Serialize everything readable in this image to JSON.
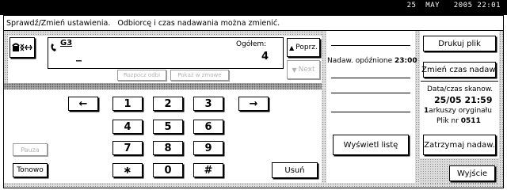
{
  "status_bar": {
    "datetime": "25  MAY   2005 22:01"
  },
  "header": {
    "message": "Sprawdź/Zmień ustawienia.   Odbiorcę i czas nadawania można zmienić."
  },
  "destination": {
    "mode_icon": "phone-fax-icon",
    "line_icon": "handset-icon",
    "line_label": "G3",
    "value": "_",
    "total_label": "Ogółem:",
    "total_value": "4",
    "tab_recipient": "Rozpocz odbi",
    "tab_change": "Pokaż w zmowe"
  },
  "nav": {
    "prev_label": "Poprz.",
    "next_label": "Next",
    "up_icon": "triangle-up-icon",
    "down_icon": "triangle-down-icon"
  },
  "keypad": {
    "left_arrow": "←",
    "right_arrow": "→",
    "keys": [
      "1",
      "2",
      "3",
      "4",
      "5",
      "6",
      "7",
      "8",
      "9",
      "∗",
      "0",
      "#"
    ],
    "pause_label": "Pauza",
    "tone_label": "Tonowo",
    "delete_label": "Usuń"
  },
  "middle": {
    "delayed_label": "Nadaw. opóźnione",
    "delayed_time": "23:00",
    "show_list_label": "Wyświetl listę"
  },
  "right": {
    "print_label": "Drukuj plik",
    "change_time_label": "Zmień czas nadaw.",
    "scan_label": "Data/czas skanow.",
    "scan_value": "25/05  21:59",
    "sheets_count": "1",
    "sheets_label": "arkuszy oryginału",
    "file_label": "Plik nr",
    "file_number": "0511",
    "hold_label": "Zatrzymaj nadaw.",
    "exit_label": "Wyjście"
  },
  "colors": {
    "background": "#ffffff",
    "ink": "#000000",
    "disabled": "#b4b4b4",
    "pattern": "#dcdcdc"
  }
}
